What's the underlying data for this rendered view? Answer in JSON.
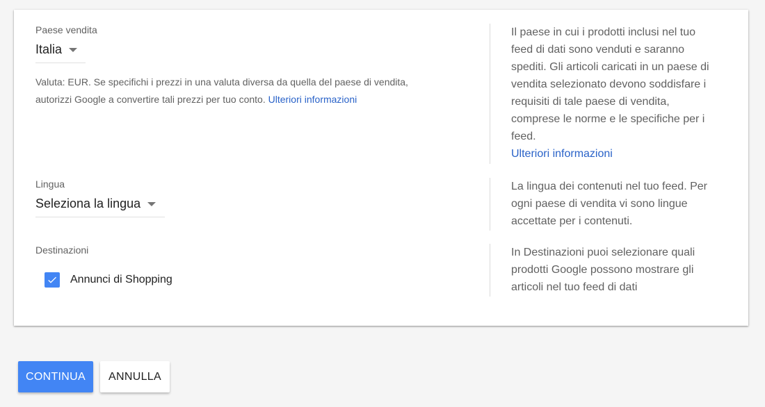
{
  "country_section": {
    "label": "Paese vendita",
    "selected": "Italia",
    "helper_text": "Valuta: EUR. Se specifichi i prezzi in una valuta diversa da quella del paese di vendita, autorizzi Google a convertire tali prezzi per tuo conto. ",
    "helper_link": "Ulteriori informazioni",
    "side_text": "Il paese in cui i prodotti inclusi nel tuo feed di dati sono venduti e saranno spediti. Gli articoli caricati in un paese di vendita selezionato devono soddisfare i requisiti di tale paese di vendita, comprese le norme e le specifiche per i feed.",
    "side_link": "Ulteriori informazioni"
  },
  "language_section": {
    "label": "Lingua",
    "selected": "Seleziona la lingua",
    "side_text": "La lingua dei contenuti nel tuo feed. Per ogni paese di vendita vi sono lingue accettate per i contenuti."
  },
  "destinations_section": {
    "label": "Destinazioni",
    "option_label": "Annunci di Shopping",
    "option_checked": true,
    "side_text": "In Destinazioni puoi selezionare quali prodotti Google possono mostrare gli articoli nel tuo feed di dati"
  },
  "actions": {
    "continue_label": "CONTINUA",
    "cancel_label": "ANNULLA"
  },
  "colors": {
    "primary": "#4285f4",
    "link": "#2962c8",
    "background": "#f5f5f5"
  }
}
